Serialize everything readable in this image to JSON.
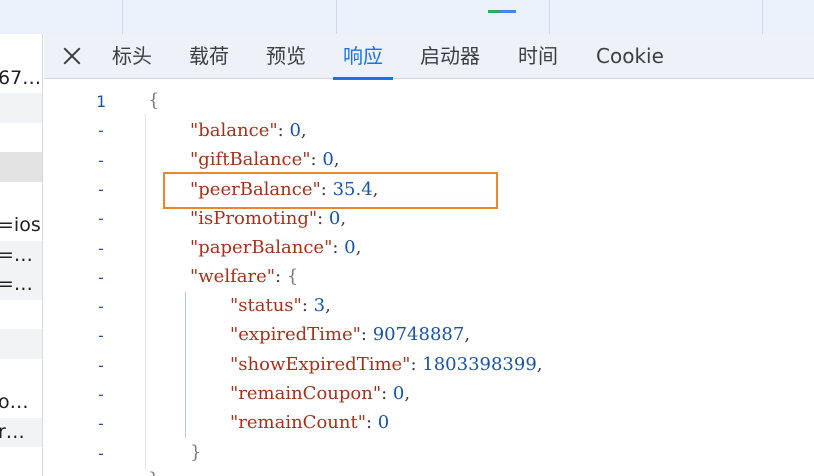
{
  "left_list": {
    "rows": [
      "",
      "67…",
      "",
      "",
      "",
      "",
      "=ios",
      "=…",
      "=…",
      "",
      "",
      "",
      "o…",
      "r…",
      ""
    ]
  },
  "tabs": [
    {
      "label": "标头",
      "active": false
    },
    {
      "label": "载荷",
      "active": false
    },
    {
      "label": "预览",
      "active": false
    },
    {
      "label": "响应",
      "active": true
    },
    {
      "label": "启动器",
      "active": false
    },
    {
      "label": "时间",
      "active": false
    },
    {
      "label": "Cookie",
      "active": false
    }
  ],
  "gutter": [
    "1",
    "-",
    "-",
    "-",
    "-",
    "-",
    "-",
    "-",
    "-",
    "-",
    "-",
    "-",
    "-"
  ],
  "json": {
    "open": "{",
    "fields": [
      {
        "key": "\"balance\"",
        "value": "0",
        "trail": ","
      },
      {
        "key": "\"giftBalance\"",
        "value": "0",
        "trail": ","
      },
      {
        "key": "\"peerBalance\"",
        "value": "35.4",
        "trail": ","
      },
      {
        "key": "\"isPromoting\"",
        "value": "0",
        "trail": ","
      },
      {
        "key": "\"paperBalance\"",
        "value": "0",
        "trail": ","
      }
    ],
    "welfare_key": "\"welfare\"",
    "welfare_open": "{",
    "welfare_fields": [
      {
        "key": "\"status\"",
        "value": "3",
        "trail": ","
      },
      {
        "key": "\"expiredTime\"",
        "value": "90748887",
        "trail": ","
      },
      {
        "key": "\"showExpiredTime\"",
        "value": "1803398399",
        "trail": ","
      },
      {
        "key": "\"remainCoupon\"",
        "value": "0",
        "trail": ","
      },
      {
        "key": "\"remainCount\"",
        "value": "0",
        "trail": ""
      }
    ],
    "welfare_close": "}",
    "close": "}"
  },
  "colors": {
    "key": "#a3321a",
    "number": "#1a55a6",
    "active_tab": "#1a73e8",
    "highlight": "#e8882b"
  }
}
